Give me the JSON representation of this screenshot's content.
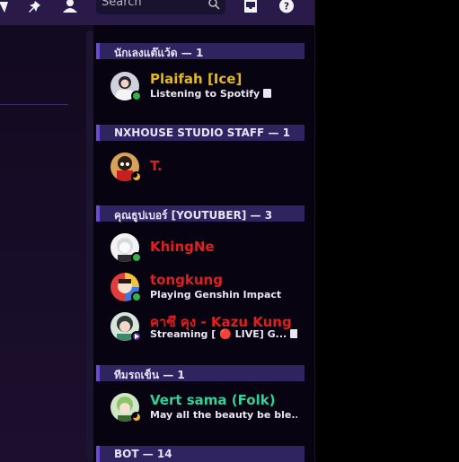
{
  "search": {
    "placeholder": "Search"
  },
  "sections": [
    {
      "title": "นักเลงแต๊แว้ด",
      "count": "— 1"
    },
    {
      "title": "NXHOUSE STUDIO STAFF",
      "count": "— 1"
    },
    {
      "title": "คุณธูปเบอร์ [YOUTUBER]",
      "count": "— 3"
    },
    {
      "title": "ทีมรถเข็น",
      "count": "— 1"
    },
    {
      "title": "BOT",
      "count": "— 14"
    }
  ],
  "members": [
    {
      "name": "Plaifah [Ice]",
      "activity_prefix": "Listening to ",
      "activity_strong": "Spotify",
      "name_color": "#e2b923",
      "status": "online"
    },
    {
      "name": "T.",
      "activity_prefix": "",
      "activity_strong": "",
      "name_color": "#e01f1f",
      "status": "idle"
    },
    {
      "name": "KhingNe",
      "activity_prefix": "",
      "activity_strong": "",
      "name_color": "#e01f1f",
      "status": "online"
    },
    {
      "name": "tongkung",
      "activity_prefix": "Playing ",
      "activity_strong": "Genshin Impact",
      "name_color": "#e01f1f",
      "status": "online"
    },
    {
      "name": "คาซึ คุง - Kazu Kung",
      "activity_prefix": "Streaming [ 🔴 LIVE] G...",
      "activity_strong": "",
      "name_color": "#e01f1f",
      "status": "stream"
    },
    {
      "name": "Vert sama (Folk)",
      "activity_prefix": "May all the beauty be ble...",
      "activity_strong": "",
      "name_color": "#2fd39a",
      "status": "idle"
    }
  ],
  "colors": {
    "accent": "#6b4bd6",
    "section_bg": "#2f2460",
    "topbar": "#2a1a4a"
  },
  "icons": [
    "thread-icon",
    "pin-icon",
    "members-icon",
    "search-icon",
    "inbox-icon",
    "help-icon",
    "rich-presence-icon"
  ]
}
